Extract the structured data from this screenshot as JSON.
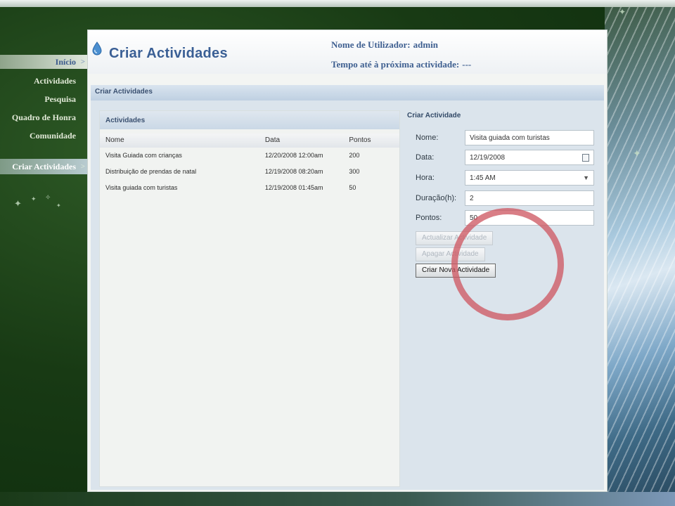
{
  "nav": {
    "items": [
      {
        "label": "Início",
        "arrow": ">"
      },
      {
        "label": "Actividades"
      },
      {
        "label": "Pesquisa"
      },
      {
        "label": "Quadro de Honra"
      },
      {
        "label": "Comunidade"
      },
      {
        "label": "Criar Actividades",
        "arrow": ">"
      }
    ]
  },
  "header": {
    "title": "Criar Actividades",
    "user_label": "Nome de Utilizador:",
    "user_value": "admin",
    "time_label": "Tempo até à próxima actividade:",
    "time_value": "---"
  },
  "section": {
    "title": "Criar Actividades"
  },
  "activities": {
    "title": "Actividades",
    "columns": [
      "Nome",
      "Data",
      "Pontos"
    ],
    "rows": [
      [
        "Visita Guiada com crianças",
        "12/20/2008 12:00am",
        "200"
      ],
      [
        "Distribuição de prendas de natal",
        "12/19/2008 08:20am",
        "300"
      ],
      [
        "Visita guiada com turistas",
        "12/19/2008 01:45am",
        "50"
      ]
    ]
  },
  "form": {
    "title": "Criar Actividade",
    "nome": {
      "label": "Nome:",
      "value": "Visita guiada com turistas"
    },
    "data": {
      "label": "Data:",
      "value": "12/19/2008"
    },
    "hora": {
      "label": "Hora:",
      "value": "1:45 AM"
    },
    "duracao": {
      "label": "Duração(h):",
      "value": "2"
    },
    "pontos": {
      "label": "Pontos:",
      "value": "50"
    },
    "buttons": {
      "edit": "Actualizar Actividade",
      "delete": "Apagar Actividade",
      "create": "Criar Nova Actividade"
    }
  },
  "colors": {
    "accent": "#3a5f95",
    "annotation": "#ce5a64"
  }
}
